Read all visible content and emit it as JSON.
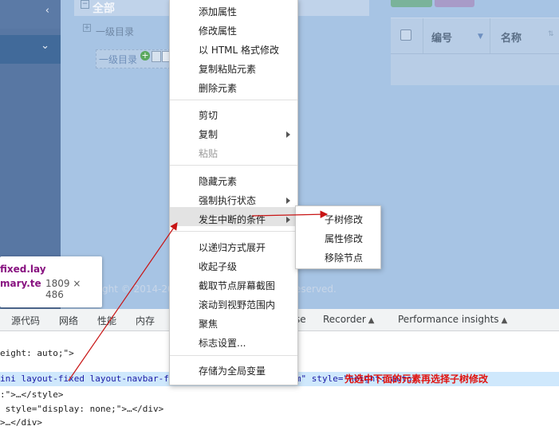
{
  "tree": {
    "root_label": "全部",
    "level1_label": "一级目录",
    "selected_label": "一级目录",
    "add_glyph": "+"
  },
  "table": {
    "col_num": "编号",
    "col_name": "名称"
  },
  "footer": {
    "copyright": "ght © 2014-20",
    "rights": "eserved."
  },
  "tooltip": {
    "line1": "fixed.lay",
    "line2": "mary.te",
    "size": "1809 × 486"
  },
  "devtools_tabs": [
    {
      "label": "源代码"
    },
    {
      "label": "网络"
    },
    {
      "label": "性能"
    },
    {
      "label": "内存"
    },
    {
      "label": "se"
    },
    {
      "label": "Recorder"
    },
    {
      "label": "Performance insights"
    }
  ],
  "code_lines": [
    {
      "text": "eight: auto;\">"
    },
    {
      "text": "ini layout-fixed layout-navbar-fixed pace-primary text-sm\" style=\"height: auto;"
    },
    {
      "text": ":\">…</style>"
    },
    {
      "text": " style=\"display: none;\">…</div>"
    },
    {
      "text": ">…</div>"
    }
  ],
  "context_menu": {
    "items": [
      {
        "label": "添加属性",
        "disabled": false,
        "submenu": false
      },
      {
        "label": "修改属性",
        "disabled": false,
        "submenu": false
      },
      {
        "label": "以 HTML 格式修改",
        "disabled": false,
        "submenu": false
      },
      {
        "label": "复制粘贴元素",
        "disabled": false,
        "submenu": false
      },
      {
        "label": "删除元素",
        "disabled": false,
        "submenu": false
      },
      {
        "label": "剪切",
        "disabled": false,
        "submenu": false
      },
      {
        "label": "复制",
        "disabled": false,
        "submenu": true
      },
      {
        "label": "粘贴",
        "disabled": true,
        "submenu": false
      },
      {
        "label": "隐藏元素",
        "disabled": false,
        "submenu": false
      },
      {
        "label": "强制执行状态",
        "disabled": false,
        "submenu": true
      },
      {
        "label": "发生中断的条件",
        "disabled": false,
        "submenu": true
      },
      {
        "label": "以递归方式展开",
        "disabled": false,
        "submenu": false
      },
      {
        "label": "收起子级",
        "disabled": false,
        "submenu": false
      },
      {
        "label": "截取节点屏幕截图",
        "disabled": false,
        "submenu": false
      },
      {
        "label": "滚动到视野范围内",
        "disabled": false,
        "submenu": false
      },
      {
        "label": "聚焦",
        "disabled": false,
        "submenu": false
      },
      {
        "label": "标志设置...",
        "disabled": false,
        "submenu": false
      },
      {
        "label": "存储为全局变量",
        "disabled": false,
        "submenu": false
      }
    ]
  },
  "submenu": {
    "items": [
      {
        "label": "子树修改"
      },
      {
        "label": "属性修改"
      },
      {
        "label": "移除节点"
      }
    ]
  },
  "annotation": {
    "text": "先选中下面的元素再选择子树修改",
    "color": "#e0140f"
  }
}
